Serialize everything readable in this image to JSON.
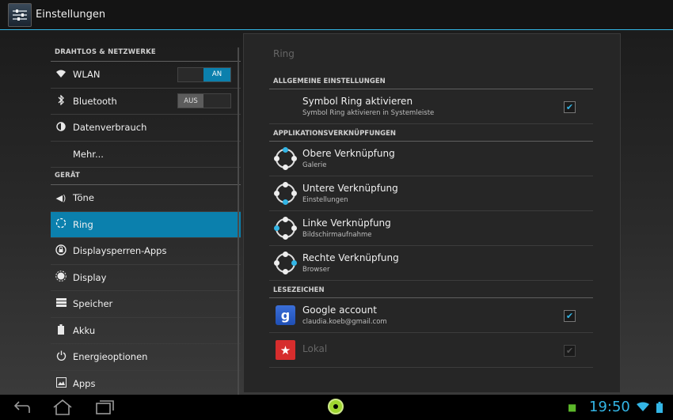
{
  "app": {
    "title": "Einstellungen"
  },
  "left": {
    "categories": [
      "DRAHTLOS & NETZWERKE",
      "GERÄT"
    ],
    "wireless": [
      {
        "label": "WLAN",
        "icon": "wifi-icon",
        "toggle": "AN",
        "toggle_state": "on"
      },
      {
        "label": "Bluetooth",
        "icon": "bluetooth-icon",
        "toggle": "AUS",
        "toggle_state": "off"
      },
      {
        "label": "Datenverbrauch",
        "icon": "data-usage-icon"
      },
      {
        "label": "Mehr...",
        "icon": ""
      }
    ],
    "device": [
      {
        "label": "Töne",
        "icon": "sound-icon"
      },
      {
        "label": "Ring",
        "icon": "ring-icon",
        "selected": true
      },
      {
        "label": "Displaysperren-Apps",
        "icon": "lock-apps-icon"
      },
      {
        "label": "Display",
        "icon": "display-icon"
      },
      {
        "label": "Speicher",
        "icon": "storage-icon"
      },
      {
        "label": "Akku",
        "icon": "battery-icon"
      },
      {
        "label": "Energieoptionen",
        "icon": "power-icon"
      },
      {
        "label": "Apps",
        "icon": "apps-icon"
      }
    ]
  },
  "right": {
    "title": "Ring",
    "cat_general": "ALLGEMEINE EINSTELLUNGEN",
    "symbol": {
      "title": "Symbol Ring aktivieren",
      "summary": "Symbol Ring aktivieren in Systemleiste",
      "checked": true
    },
    "cat_shortcuts": "APPLIKATIONSVERKNÜPFUNGEN",
    "shortcuts": [
      {
        "title": "Obere Verknüpfung",
        "summary": "Galerie"
      },
      {
        "title": "Untere Verknüpfung",
        "summary": "Einstellungen"
      },
      {
        "title": "Linke Verknüpfung",
        "summary": "Bildschirmaufnahme"
      },
      {
        "title": "Rechte Verknüpfung",
        "summary": "Browser"
      }
    ],
    "cat_bookmarks": "LESEZEICHEN",
    "google": {
      "title": "Google account",
      "summary": "claudia.koeb@gmail.com",
      "checked": true
    },
    "lokal": {
      "title": "Lokal",
      "checked": true,
      "enabled": false
    }
  },
  "status": {
    "time": "19:50"
  },
  "colors": {
    "accent": "#33b5e5",
    "selected": "#0b80ad"
  }
}
